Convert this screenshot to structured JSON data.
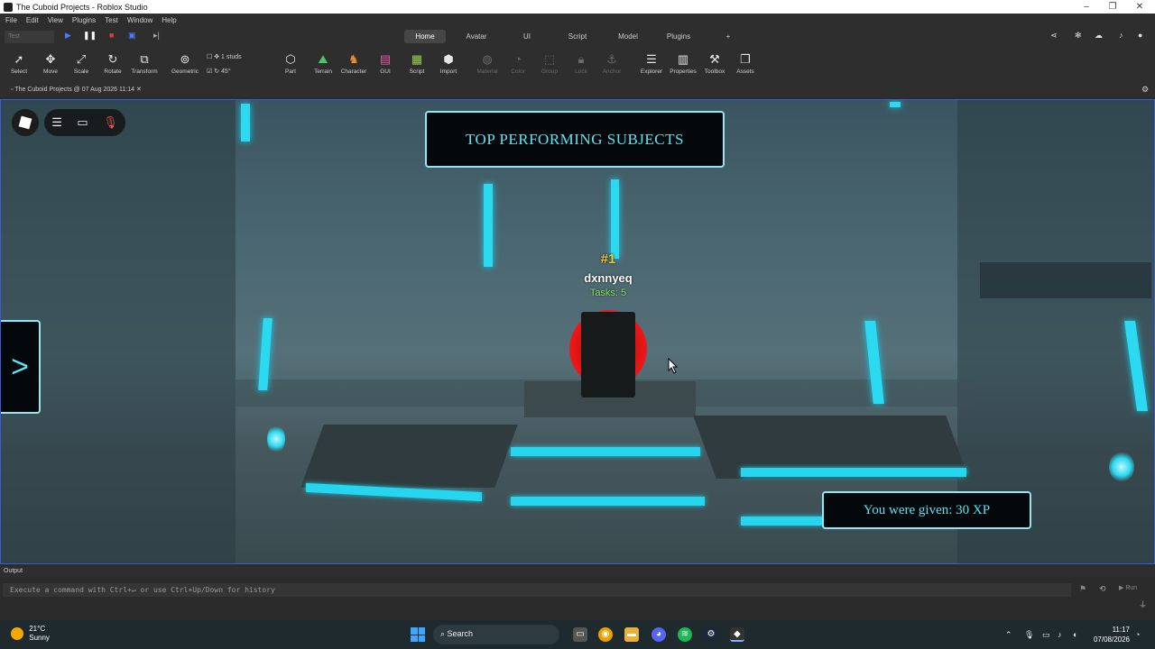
{
  "window": {
    "title": "The Cuboid Projects - Roblox Studio"
  },
  "menu": [
    "File",
    "Edit",
    "View",
    "Plugins",
    "Test",
    "Window",
    "Help"
  ],
  "test_selector": "Test",
  "ribbon_tabs": [
    {
      "label": "Home",
      "active": true
    },
    {
      "label": "Avatar",
      "active": false
    },
    {
      "label": "UI",
      "active": false
    },
    {
      "label": "Script",
      "active": false
    },
    {
      "label": "Model",
      "active": false
    },
    {
      "label": "Plugins",
      "active": false
    }
  ],
  "tools": {
    "select": "Select",
    "move": "Move",
    "scale": "Scale",
    "rotate": "Rotate",
    "transform": "Transform",
    "geometric": "Geometric",
    "part": "Part",
    "terrain": "Terrain",
    "character": "Character",
    "gui": "GUI",
    "script": "Script",
    "import": "Import",
    "material": "Material",
    "color": "Color",
    "group": "Group",
    "lock": "Lock",
    "anchor": "Anchor",
    "explorer": "Explorer",
    "properties": "Properties",
    "toolbox": "Toolbox",
    "assets": "Assets"
  },
  "snap": {
    "studs": "1 studs",
    "angle": "45°"
  },
  "doc_tab": "The Cuboid Projects @ 07 Aug 2026 11:14",
  "game": {
    "banner": "TOP PERFORMING SUBJECTS",
    "rank": "#1",
    "username": "dxnnyeq",
    "tasks": "Tasks: 5",
    "toast": "You were given: 30 XP",
    "side_arrow": ">"
  },
  "output": {
    "header": "Output",
    "placeholder": "Execute a command with Ctrl+↵ or use Ctrl+Up/Down for history",
    "run": "Run"
  },
  "taskbar": {
    "temp": "21°C",
    "weather": "Sunny",
    "search": "Search",
    "time": "11:17",
    "date": "07/08/2026"
  }
}
